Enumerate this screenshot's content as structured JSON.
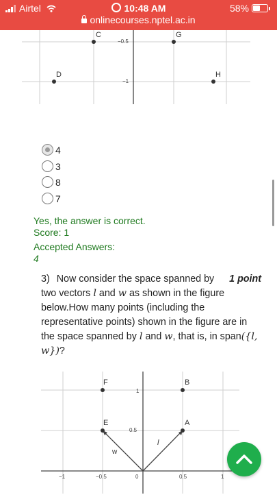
{
  "status_bar": {
    "carrier": "Airtel",
    "time": "10:48 AM",
    "battery": "58%",
    "battery_level": 0.58,
    "url": "onlinecourses.nptel.ac.in"
  },
  "top_figure": {
    "tick_neg_half": "−0.5",
    "tick_neg_one": "−1",
    "points": {
      "c": "C",
      "g": "G",
      "d": "D",
      "h": "H"
    }
  },
  "options": [
    {
      "label": "4",
      "selected": true
    },
    {
      "label": "3",
      "selected": false
    },
    {
      "label": "8",
      "selected": false
    },
    {
      "label": "7",
      "selected": false
    }
  ],
  "feedback": {
    "result": "Yes, the answer is correct.",
    "score": "Score: 1",
    "accepted_heading": "Accepted Answers:",
    "accepted_value": "4"
  },
  "question": {
    "number": "3)",
    "points": "1 point",
    "text_1": "Now consider the space spanned by two",
    "text_2": "vectors",
    "var_l": "l",
    "text_and": "and",
    "var_w": "w",
    "text_3": "as shown in the figure below.How many points (including the representative points) shown in the figure are in the space spanned by",
    "text_4": "and",
    "text_5": ", that is, in span",
    "span_set": "({l, w})",
    "text_end": "?"
  },
  "bottom_figure": {
    "tick_one": "1",
    "tick_half": "0.5",
    "tick_zero": "0",
    "x_neg_one": "−1",
    "x_neg_half": "−0.5",
    "x_half": "0.5",
    "x_one": "1",
    "vector_l": "l",
    "vector_w": "w",
    "points": {
      "f": "F",
      "b": "B",
      "e": "E",
      "a": "A"
    }
  },
  "fab": {
    "icon": "chevron-up-icon"
  }
}
